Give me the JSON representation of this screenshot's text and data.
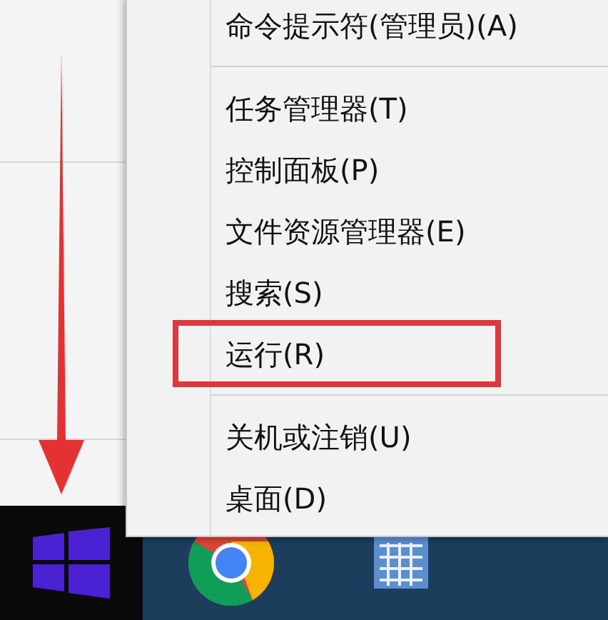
{
  "menu": {
    "sections": [
      {
        "items": [
          {
            "label": "命令提示符(管理员)(A)",
            "highlighted": false
          }
        ]
      },
      {
        "items": [
          {
            "label": "任务管理器(T)",
            "highlighted": false
          },
          {
            "label": "控制面板(P)",
            "highlighted": false
          },
          {
            "label": "文件资源管理器(E)",
            "highlighted": false
          },
          {
            "label": "搜索(S)",
            "highlighted": false
          },
          {
            "label": "运行(R)",
            "highlighted": true
          }
        ]
      },
      {
        "items": [
          {
            "label": "关机或注销(U)",
            "highlighted": false
          },
          {
            "label": "桌面(D)",
            "highlighted": false
          }
        ]
      }
    ]
  }
}
